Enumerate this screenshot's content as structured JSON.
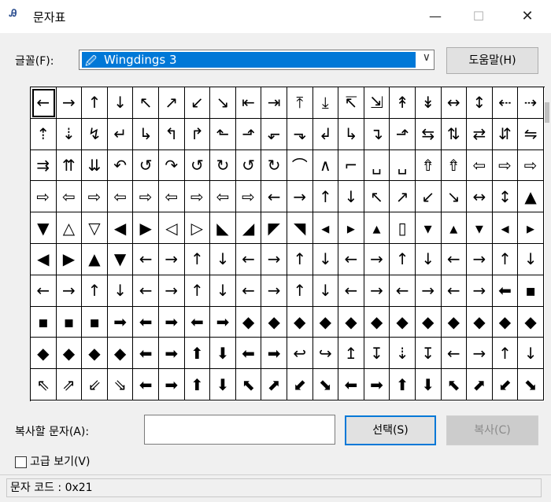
{
  "window": {
    "title": "문자표",
    "icon": "charmap-icon",
    "controls": {
      "minimize": "—",
      "maximize": "☐",
      "close": "✕"
    }
  },
  "font": {
    "label": "글꼴(F):",
    "selected": "Wingdings 3",
    "font_icon": "font-icon",
    "dropdown_arrow": "∨",
    "help_button": "도움말(H)"
  },
  "grid": {
    "columns": 20,
    "selected_index": 0,
    "cells": [
      "←",
      "→",
      "↑",
      "↓",
      "↖",
      "↗",
      "↙",
      "↘",
      "⇤",
      "⇥",
      "⤒",
      "⤓",
      "↸",
      "⇲",
      "↟",
      "↡",
      "↔",
      "↕",
      "⇠",
      "⇢",
      "⇡",
      "⇣",
      "↯",
      "↵",
      "↳",
      "↰",
      "↱",
      "⬑",
      "⬏",
      "⬐",
      "⬎",
      "↲",
      "↳",
      "↴",
      "⬏",
      "⇆",
      "⇅",
      "⇄",
      "⇵",
      "⇋",
      "⇉",
      "⇈",
      "⇊",
      "↶",
      "↺",
      "↷",
      "↺",
      "↻",
      "↺",
      "↻",
      "⌒",
      "∧",
      "⌐",
      "␣",
      "␣",
      "⇮",
      "⇮",
      "⇦",
      "⇨",
      "⇨",
      "⇨",
      "⇦",
      "⇨",
      "⇦",
      "⇨",
      "⇦",
      "⇨",
      "⇦",
      "⇨",
      "←",
      "→",
      "↑",
      "↓",
      "↖",
      "↗",
      "↙",
      "↘",
      "↔",
      "↕",
      "▲",
      "▼",
      "△",
      "▽",
      "◀",
      "▶",
      "◁",
      "▷",
      "◣",
      "◢",
      "◤",
      "◥",
      "◂",
      "▸",
      "▴",
      "▯",
      "▾",
      "▴",
      "▾",
      "◂",
      "▸",
      "◀",
      "▶",
      "▲",
      "▼",
      "←",
      "→",
      "↑",
      "↓",
      "←",
      "→",
      "↑",
      "↓",
      "←",
      "→",
      "↑",
      "↓",
      "←",
      "→",
      "↑",
      "↓",
      "←",
      "→",
      "↑",
      "↓",
      "←",
      "→",
      "↑",
      "↓",
      "←",
      "→",
      "↑",
      "↓",
      "←",
      "→",
      "←",
      "→",
      "←",
      "→",
      "⬅",
      "▪",
      "▪",
      "▪",
      "▪",
      "➡",
      "⬅",
      "➡",
      "⬅",
      "➡",
      "◆",
      "◆",
      "◆",
      "◆",
      "◆",
      "◆",
      "◆",
      "◆",
      "◆",
      "◆",
      "◆",
      "◆",
      "◆",
      "◆",
      "◆",
      "◆",
      "⬅",
      "➡",
      "⬆",
      "⬇",
      "⬅",
      "➡",
      "↩",
      "↪",
      "↥",
      "↧",
      "⇣",
      "↧",
      "←",
      "→",
      "↑",
      "↓",
      "⇖",
      "⇗",
      "⇙",
      "⇘",
      "⬅",
      "➡",
      "⬆",
      "⬇",
      "⬉",
      "⬈",
      "⬋",
      "⬊",
      "⬅",
      "➡",
      "⬆",
      "⬇",
      "⬉",
      "⬈",
      "⬋",
      "⬊"
    ]
  },
  "copy": {
    "label": "복사할 문자(A):",
    "value": "",
    "select_button": "선택(S)",
    "copy_button": "복사(C)"
  },
  "advanced": {
    "label": "고급 보기(V)",
    "checked": false
  },
  "status": {
    "text": "문자 코드 : 0x21"
  }
}
